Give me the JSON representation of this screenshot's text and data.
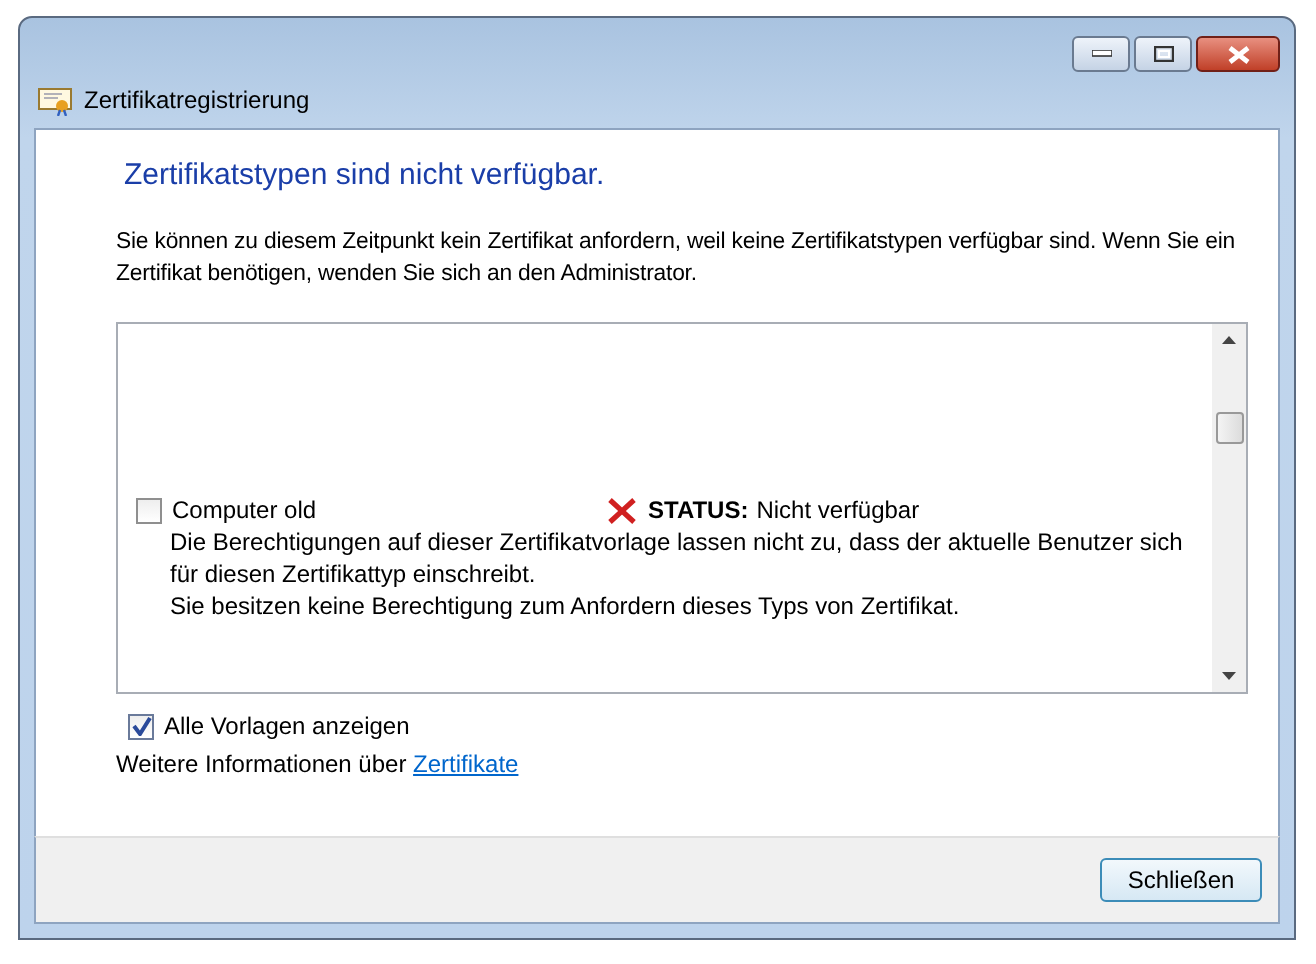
{
  "window": {
    "title": "Zertifikatregistrierung"
  },
  "heading": "Zertifikatstypen sind nicht verfügbar.",
  "message": "Sie können zu diesem Zeitpunkt kein Zertifikat anfordern, weil keine Zertifikatstypen verfügbar sind. Wenn Sie ein Zertifikat benötigen, wenden Sie sich an den Administrator.",
  "templates": [
    {
      "name": "Computer old",
      "checked": false,
      "status_label": "STATUS:",
      "status": "Nicht verfügbar",
      "details": [
        "Die Berechtigungen auf dieser Zertifikatvorlage lassen nicht zu, dass der aktuelle Benutzer sich für diesen Zertifikattyp einschreibt.",
        "Sie besitzen keine Berechtigung zum Anfordern dieses Typs von Zertifikat."
      ]
    }
  ],
  "show_all": {
    "label": "Alle Vorlagen anzeigen",
    "checked": true
  },
  "more_info": {
    "text": "Weitere Informationen über",
    "link": "Zertifikate"
  },
  "buttons": [
    "Schließen"
  ]
}
